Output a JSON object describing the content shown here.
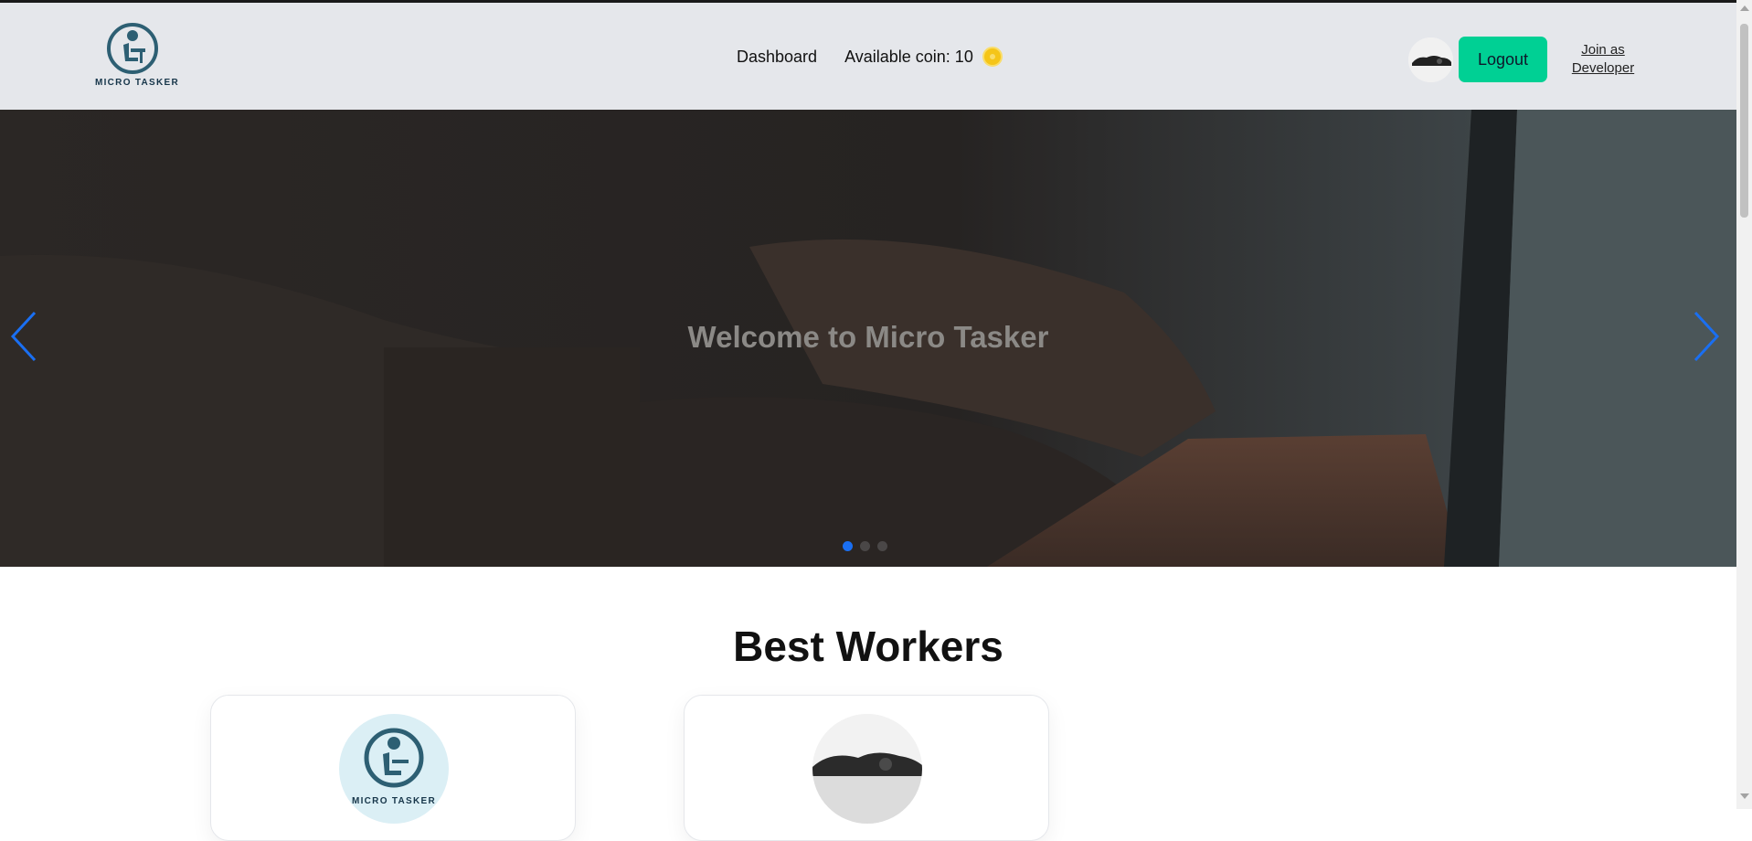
{
  "brand": {
    "name": "MICRO TASKER",
    "icon": "worker-desk-logo-icon"
  },
  "nav": {
    "dashboard": "Dashboard",
    "coins_label": "Available coin: 10",
    "coin_icon": "coin-icon",
    "logout": "Logout",
    "join_line1": "Join as",
    "join_line2": "Developer",
    "accent_color": "#00d094"
  },
  "hero": {
    "title": "Welcome to Micro Tasker",
    "slides": 3,
    "active_slide": 1,
    "prev_icon": "chevron-left-icon",
    "next_icon": "chevron-right-icon",
    "accent_color": "#1a6ff2"
  },
  "best_workers": {
    "title": "Best Workers",
    "cards": [
      {
        "avatar": "micro-tasker-logo",
        "logo_text": "MICRO TASKER"
      },
      {
        "avatar": "photo-avatar"
      }
    ]
  }
}
